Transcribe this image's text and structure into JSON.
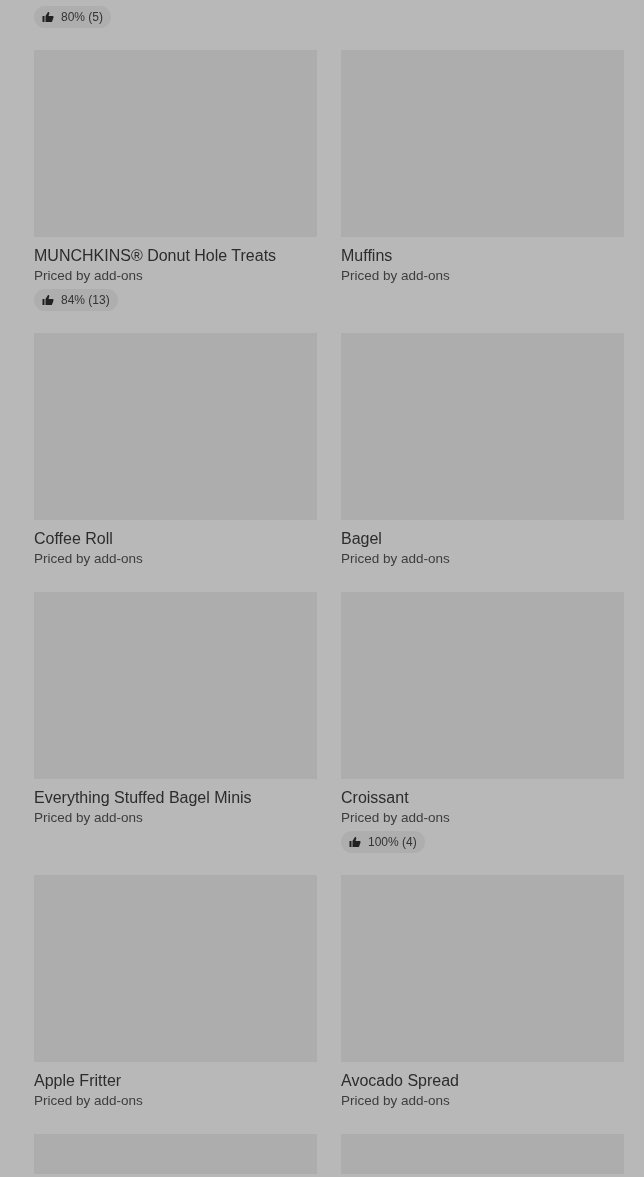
{
  "top_partial": {
    "rating": "80% (5)"
  },
  "items": [
    {
      "name": "MUNCHKINS® Donut Hole Treats",
      "price": "Priced by add-ons",
      "rating": "84% (13)"
    },
    {
      "name": "Muffins",
      "price": "Priced by add-ons"
    },
    {
      "name": "Coffee Roll",
      "price": "Priced by add-ons"
    },
    {
      "name": "Bagel",
      "price": "Priced by add-ons"
    },
    {
      "name": "Everything Stuffed Bagel Minis",
      "price": "Priced by add-ons"
    },
    {
      "name": "Croissant",
      "price": "Priced by add-ons",
      "rating": "100% (4)"
    },
    {
      "name": "Apple Fritter",
      "price": "Priced by add-ons"
    },
    {
      "name": "Avocado Spread",
      "price": "Priced by add-ons"
    },
    {
      "kind": "placeholder"
    },
    {
      "kind": "placeholder"
    }
  ]
}
